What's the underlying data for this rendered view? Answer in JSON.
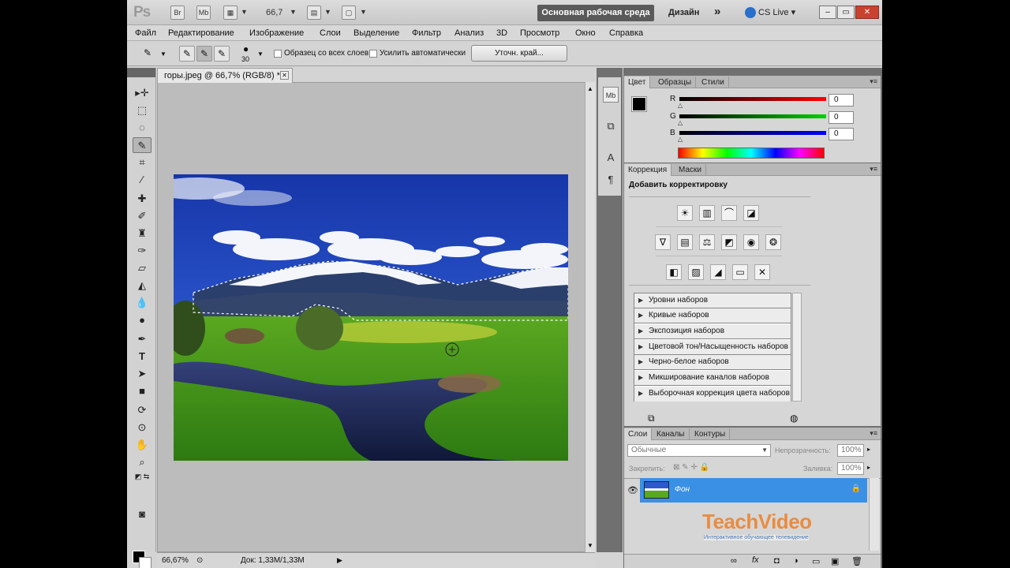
{
  "app": {
    "logo": "Ps",
    "bridge_label": "Br",
    "minibridge_label": "Mb",
    "zoom": "66,7",
    "workspace_active": "Основная рабочая среда",
    "workspace_design": "Дизайн",
    "more": "»",
    "cslive": "CS Live",
    "win_min": "–",
    "win_max": "▭",
    "win_close": "✕"
  },
  "menu": [
    "Файл",
    "Редактирование",
    "Изображение",
    "Слои",
    "Выделение",
    "Фильтр",
    "Анализ",
    "3D",
    "Просмотр",
    "Окно",
    "Справка"
  ],
  "options": {
    "brush_size": "30",
    "sample_all": "Образец со всех слоев",
    "auto_enhance": "Усилить автоматически",
    "refine_edge": "Уточн. край..."
  },
  "document": {
    "tab_title": "горы.jpeg @ 66,7% (RGB/8) *",
    "zoom_status": "66,67%",
    "doc_status": "Док: 1,33M/1,33M"
  },
  "color_panel": {
    "tabs": [
      "Цвет",
      "Образцы",
      "Стили"
    ],
    "channels": [
      {
        "name": "R",
        "value": "0",
        "color": "#d00000"
      },
      {
        "name": "G",
        "value": "0",
        "color": "#18b018"
      },
      {
        "name": "B",
        "value": "0",
        "color": "#1010c8"
      }
    ]
  },
  "adjust_panel": {
    "tabs": [
      "Коррекция",
      "Маски"
    ],
    "heading": "Добавить корректировку",
    "presets": [
      "Уровни наборов",
      "Кривые наборов",
      "Экспозиция наборов",
      "Цветовой тон/Насыщенность наборов",
      "Черно-белое наборов",
      "Микширование каналов наборов",
      "Выборочная коррекция цвета наборов"
    ]
  },
  "layers_panel": {
    "tabs": [
      "Слои",
      "Каналы",
      "Контуры"
    ],
    "blend_mode": "Обычные",
    "opacity_label": "Непрозрачность:",
    "opacity": "100%",
    "lock_label": "Закрепить:",
    "fill_label": "Заливка:",
    "fill": "100%",
    "layer_name": "Фон"
  },
  "watermark": {
    "brand": "TeachVideo",
    "tagline": "Интерактивное обучающее телевидение"
  },
  "colors": {
    "accent": "#3a90e4",
    "workspace_btn": "#5a5a5a"
  }
}
